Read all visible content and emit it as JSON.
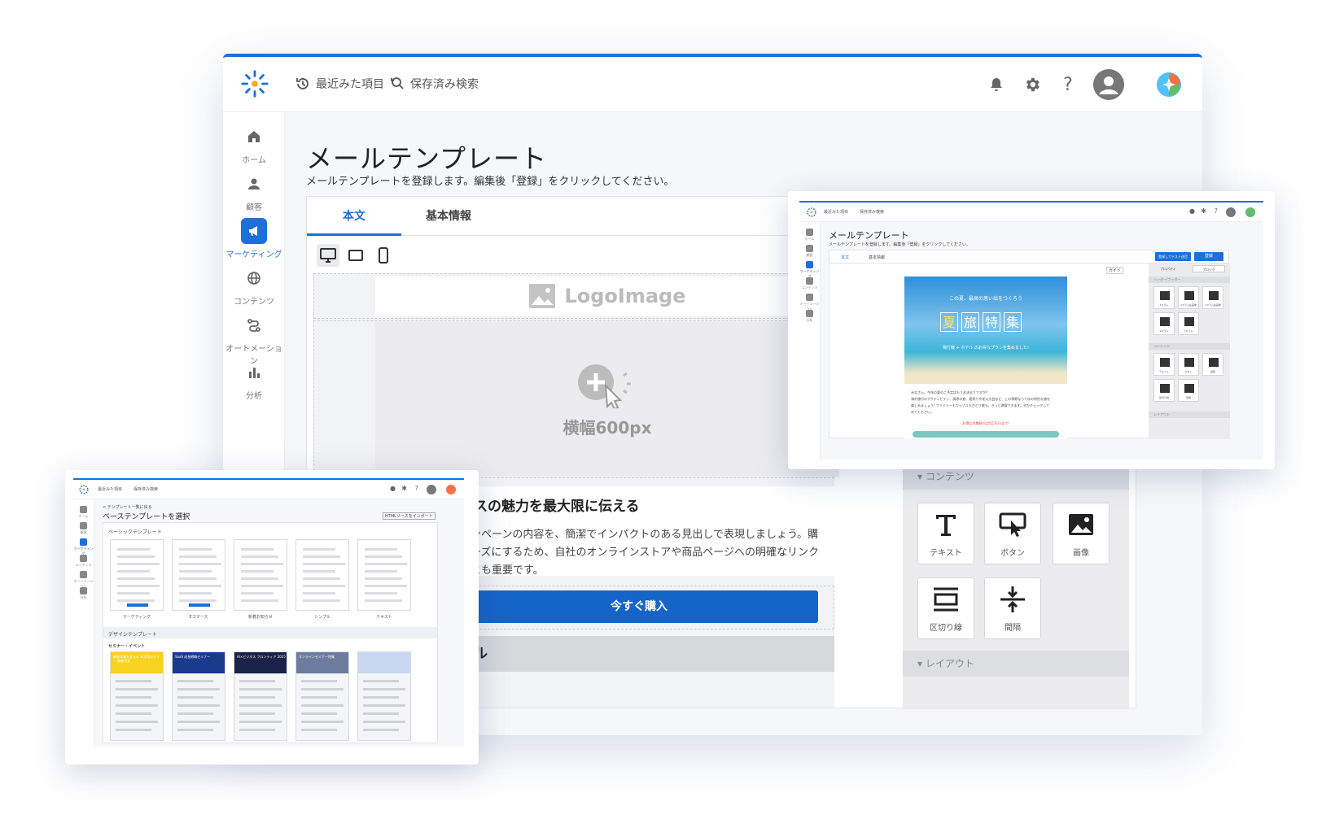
{
  "header": {
    "recent_label": "最近みた項目",
    "saved_search_label": "保存済み検索"
  },
  "sidebar": {
    "items": [
      {
        "label": "ホーム"
      },
      {
        "label": "顧客"
      },
      {
        "label": "マーケティング"
      },
      {
        "label": "コンテンツ"
      },
      {
        "label": "オートメーション"
      },
      {
        "label": "分析"
      }
    ]
  },
  "page": {
    "title": "メールテンプレート",
    "subtitle": "メールテンプレートを登録します。編集後「登録」をクリックしてください。"
  },
  "tabs": [
    {
      "label": "本文"
    },
    {
      "label": "基本情報"
    }
  ],
  "canvas": {
    "logo_label": "LogoImage",
    "image_width_label": "横幅600px",
    "headline": "ビスの魅力を最大限に伝える",
    "body_lines": [
      "ャンペーンの内容を、簡潔でインパクトのある見出しで表現しましょう。購",
      "ムーズにするため、自社のオンラインストアや商品ページへの明確なリンク",
      "ことも重要です。"
    ],
    "buy_button": "今すぐ購入",
    "footer_heading": "ール"
  },
  "block_panel": {
    "contents_section": "コンテンツ",
    "layout_section": "レイアウト",
    "blocks": [
      {
        "label": "テキスト",
        "icon": "text-icon"
      },
      {
        "label": "ボタン",
        "icon": "button-icon"
      },
      {
        "label": "画像",
        "icon": "image-icon"
      },
      {
        "label": "区切り線",
        "icon": "divider-icon"
      },
      {
        "label": "間隔",
        "icon": "spacer-icon"
      }
    ]
  },
  "mini_right": {
    "recent_label": "最近みた項目",
    "saved_label": "保存済み検索",
    "sidebar": [
      "ホーム",
      "顧客",
      "マーケティング",
      "コンテンツ",
      "オートメーション",
      "分析"
    ],
    "title": "メールテンプレート",
    "subtitle": "メールテンプレートを登録します。編集後「登録」をクリックしてください。",
    "tabs": [
      "本文",
      "基本情報"
    ],
    "test_send": "登録してテスト送信",
    "register": "登録",
    "guide": "ガイド",
    "props_tab": "プロパティ",
    "block_tab": "ブロック",
    "banner_line1": "この夏、最高の思い出をつくろう",
    "banner_big": [
      "夏",
      "旅",
      "特",
      "集"
    ],
    "banner_line2": "飛行機 + ホテル のお得なプランを集めました!",
    "body_lines": [
      "みなさん、今年の夏のご予定はもうお決まりですか?",
      "海外旅行のアクティビティ、高原の旅、夏祭りや花火大会など、この季節ならではの特別な旅を",
      "楽しみましょう! ファミリーもカップルもひとり旅も、きっと満喫できます。ぜひチェックして",
      "みてください。"
    ],
    "deadline": "お得な早期割引は5月31日まで!",
    "sections": [
      "ヘッダー/フッター",
      "コンテンツ",
      "レイアウト"
    ],
    "panel_labels": [
      "1カラム",
      "1カラム左画像",
      "1カラム右画像",
      "2カラム",
      "3カラム",
      "テキスト",
      "ボタン",
      "画像",
      "区切り線",
      "間隔"
    ]
  },
  "mini_left": {
    "recent_label": "最近みた項目",
    "saved_label": "保存済み検索",
    "sidebar": [
      "ホーム",
      "顧客",
      "マーケティング",
      "コンテンツ",
      "オートメーション",
      "分析"
    ],
    "back_link": "< テンプレート一覧に戻る",
    "title": "ベーステンプレートを選択",
    "import_label": "HTMLソースをインポート",
    "basic_section": "ベーシックテンプレート",
    "basic_templates": [
      "マーケティング",
      "Eコマース",
      "新着お知らせ",
      "シンプル",
      "テキスト"
    ],
    "design_section": "デザインテンプレート",
    "seminar_heading": "セミナー・イベント",
    "design_thumbs": [
      {
        "caption": "顧客体験を変える AI活用セミナー 開催決定",
        "color": "#f7d21e"
      },
      {
        "caption": "SaaS 成長戦略セミナー",
        "color": "#1b3a8c"
      },
      {
        "caption": "AI×ビジネス フロンティア 2025",
        "color": "#1b2247"
      },
      {
        "caption": "オンラインセミナー特集",
        "color": "#6d7c9c"
      },
      {
        "caption": "",
        "color": "#c9d8f0"
      }
    ]
  },
  "colors": {
    "accent": "#1e6fd9",
    "button": "#1565c8"
  }
}
